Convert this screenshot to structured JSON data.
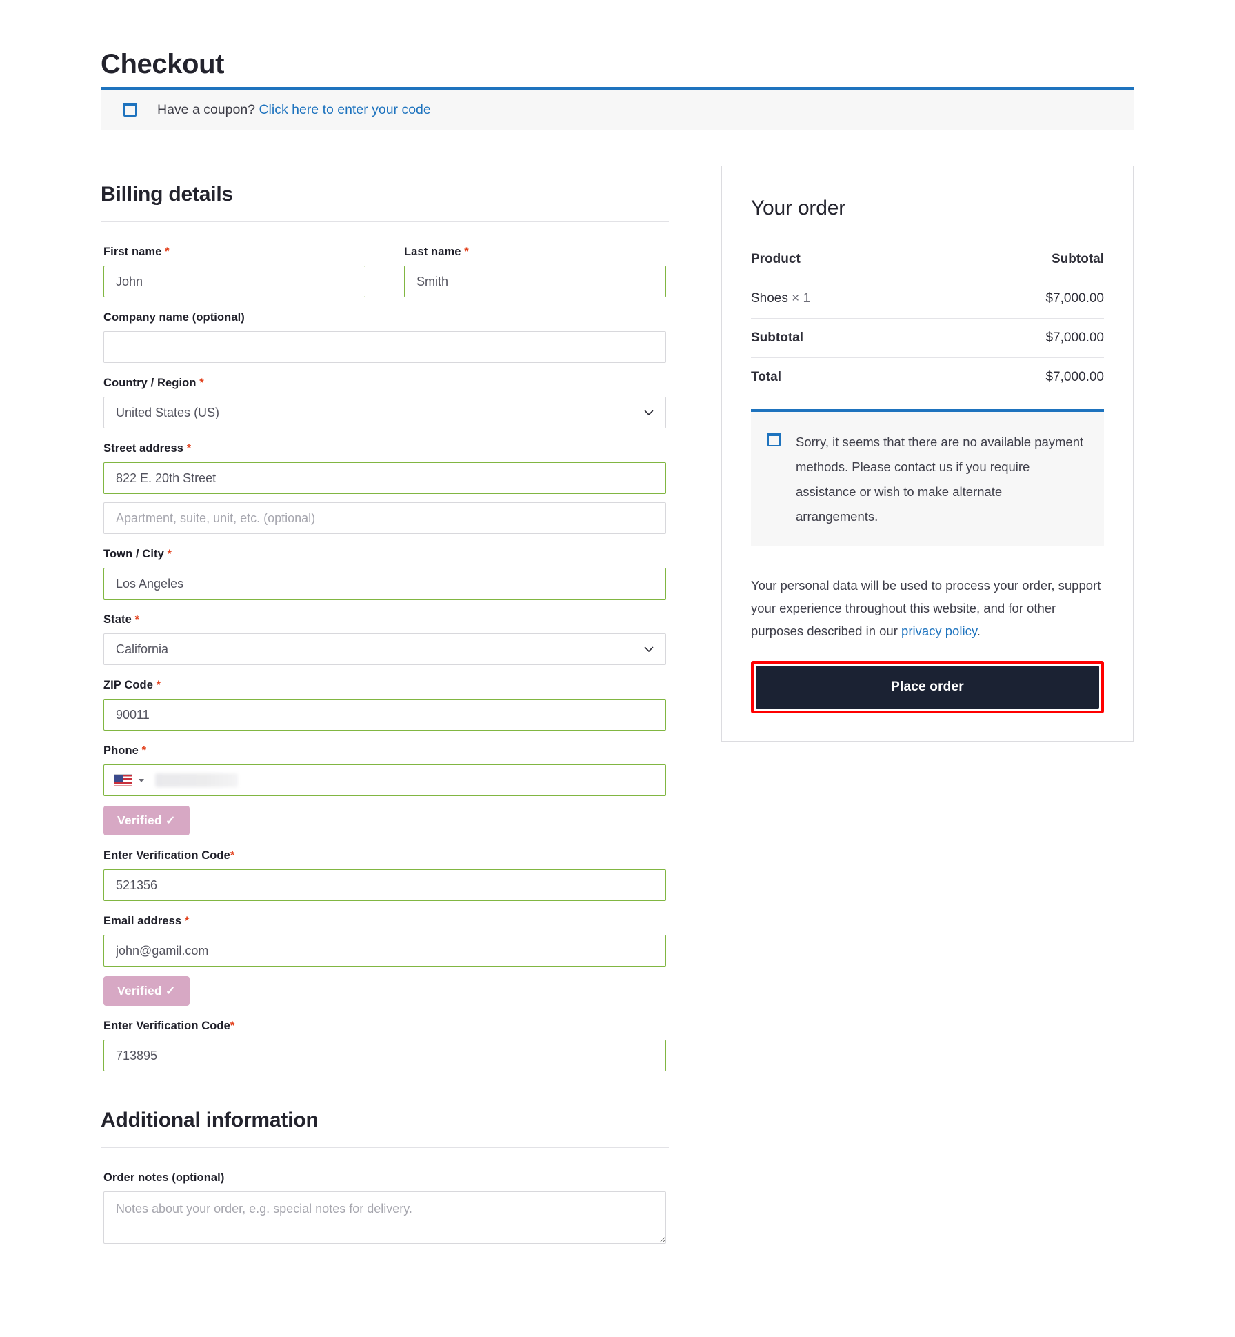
{
  "page": {
    "title": "Checkout"
  },
  "coupon": {
    "icon": "coupon-tag-icon",
    "prompt": "Have a coupon?",
    "link_label": "Click here to enter your code",
    "link_color": "#1e73be"
  },
  "billing": {
    "section_title": "Billing details",
    "first_name": {
      "label": "First name",
      "required_mark": "*",
      "value": "John"
    },
    "last_name": {
      "label": "Last name",
      "required_mark": "*",
      "value": "Smith"
    },
    "company": {
      "label": "Company name (optional)",
      "value": "",
      "placeholder": ""
    },
    "country": {
      "label": "Country / Region",
      "required_mark": "*",
      "value": "United States (US)"
    },
    "street": {
      "label": "Street address",
      "required_mark": "*",
      "value": "822 E. 20th Street"
    },
    "apartment": {
      "value": "",
      "placeholder": "Apartment, suite, unit, etc. (optional)"
    },
    "city": {
      "label": "Town / City",
      "required_mark": "*",
      "value": "Los Angeles"
    },
    "state": {
      "label": "State",
      "required_mark": "*",
      "value": "California"
    },
    "zip": {
      "label": "ZIP Code",
      "required_mark": "*",
      "value": "90011"
    },
    "phone": {
      "label": "Phone",
      "required_mark": "*",
      "country_flag": "us-flag-icon",
      "value": "",
      "masked": true,
      "verified_label": "Verified ✓",
      "verified_bg": "#d7a8c4"
    },
    "phone_code": {
      "label": "Enter Verification Code",
      "required_mark": "*",
      "value": "521356"
    },
    "email": {
      "label": "Email address",
      "required_mark": "*",
      "value": "john@gamil.com",
      "verified_label": "Verified ✓"
    },
    "email_code": {
      "label": "Enter Verification Code",
      "required_mark": "*",
      "value": "713895"
    }
  },
  "additional": {
    "section_title": "Additional information",
    "order_notes": {
      "label": "Order notes (optional)",
      "value": "",
      "placeholder": "Notes about your order, e.g. special notes for delivery."
    }
  },
  "order": {
    "title": "Your order",
    "columns": {
      "product": "Product",
      "subtotal": "Subtotal"
    },
    "rows": [
      {
        "label": "Shoes",
        "qty": "× 1",
        "amount": "$7,000.00",
        "bold": false
      },
      {
        "label": "Subtotal",
        "qty": "",
        "amount": "$7,000.00",
        "bold": true
      },
      {
        "label": "Total",
        "qty": "",
        "amount": "$7,000.00",
        "bold": true
      }
    ],
    "payment_notice": {
      "icon": "info-box-icon",
      "text": "Sorry, it seems that there are no available payment methods. Please contact us if you require assistance or wish to make alternate arrangements."
    },
    "privacy_text_before": "Your personal data will be used to process your order, support your experience throughout this website, and for other purposes described in our ",
    "privacy_link": "privacy policy",
    "privacy_text_after": ".",
    "place_order_label": "Place order",
    "place_order_bg": "#1b2233",
    "highlight_color": "#ff0000"
  }
}
